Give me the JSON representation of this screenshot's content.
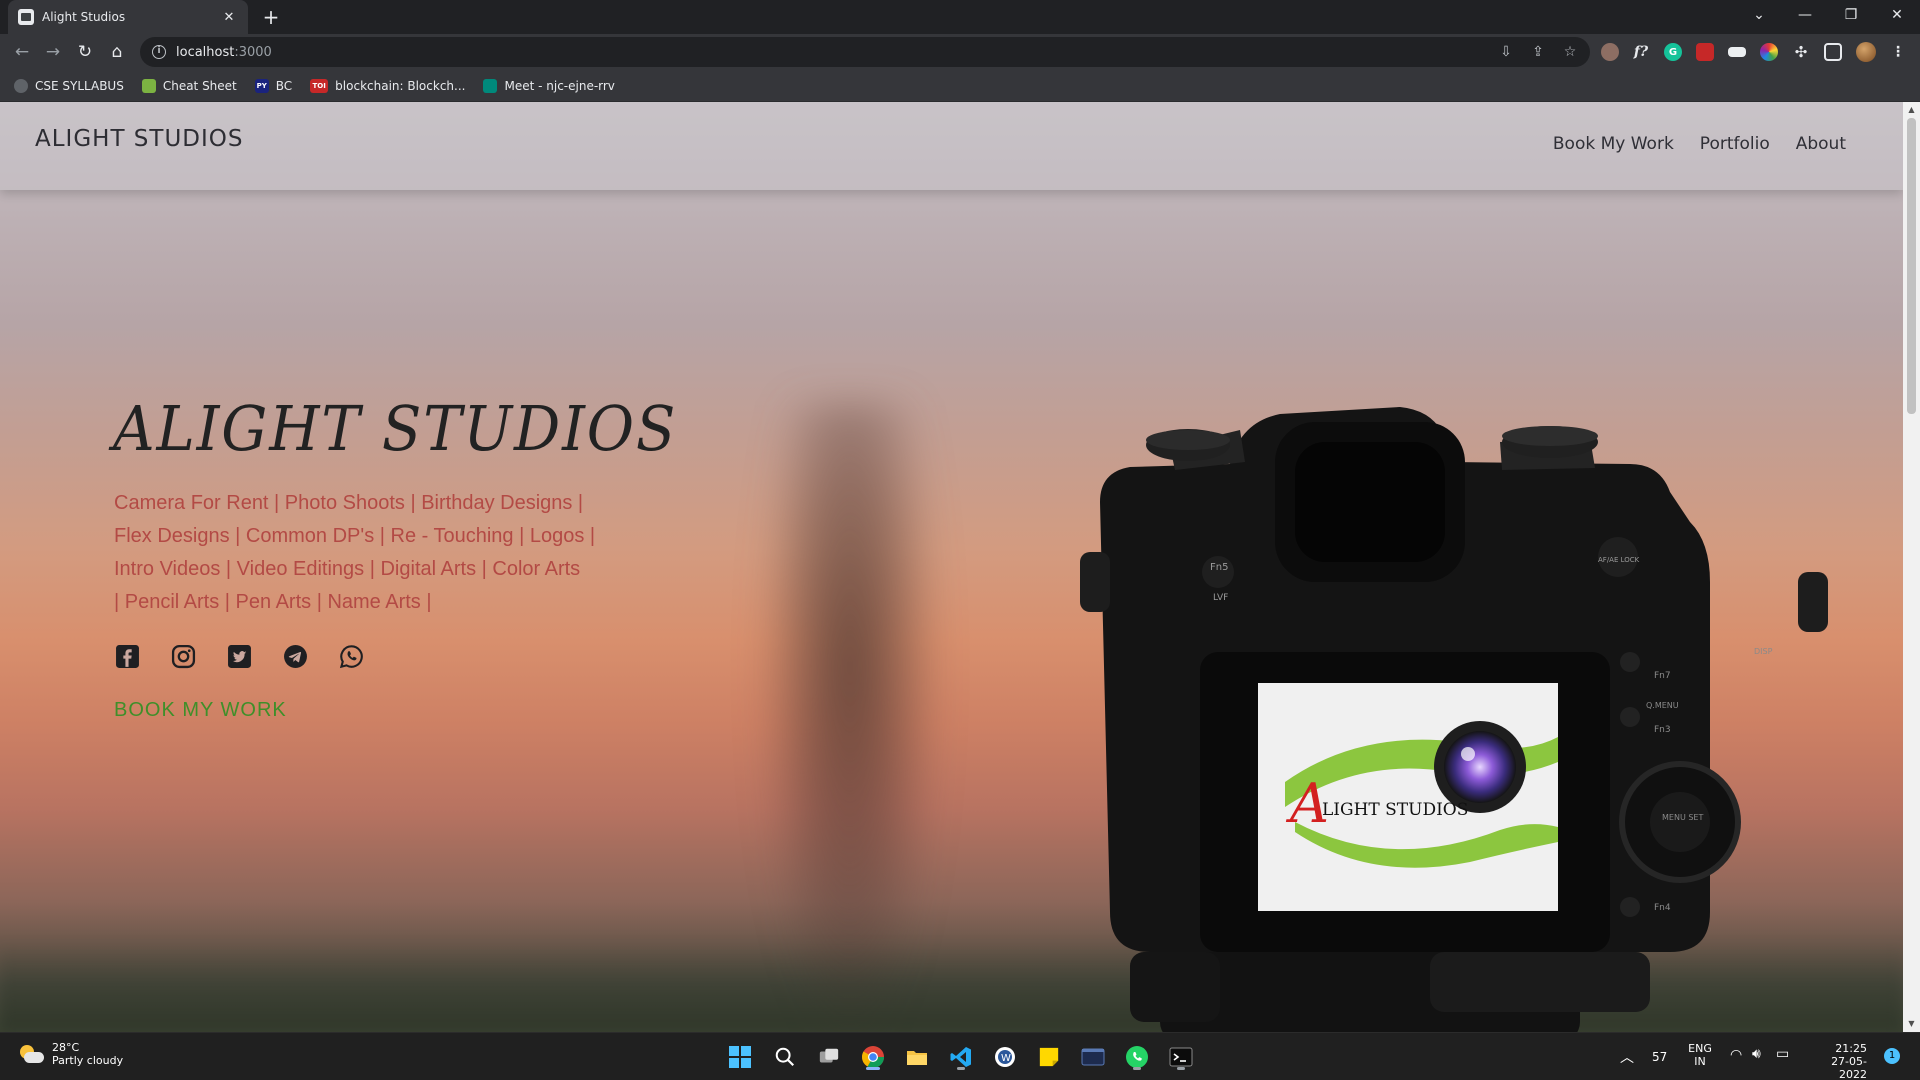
{
  "browser": {
    "tab_title": "Alight Studios",
    "tab_close": "✕",
    "new_tab": "+",
    "url_host": "localhost",
    "url_port": ":3000",
    "window_controls": [
      "⌄",
      "—",
      "❐",
      "✕"
    ]
  },
  "bookmarks": [
    {
      "label": "CSE SYLLABUS",
      "icon": "globe-icon",
      "color": "#5f6368",
      "glyph": ""
    },
    {
      "label": "Cheat Sheet",
      "icon": "cheat-sheet-icon",
      "color": "#7cb342",
      "glyph": ""
    },
    {
      "label": "BC",
      "icon": "py-icon",
      "color": "#1a237e",
      "glyph": "PY"
    },
    {
      "label": "blockchain: Blockch...",
      "icon": "toi-icon",
      "color": "#c62828",
      "glyph": "TOI"
    },
    {
      "label": "Meet - njc-ejne-rrv",
      "icon": "meet-icon",
      "color": "#00897b",
      "glyph": ""
    }
  ],
  "site": {
    "brand": "ALIGHT STUDIOS",
    "nav": [
      "Book My Work",
      "Portfolio",
      "About"
    ],
    "hero_title": "ALIGHT STUDIOS",
    "services_lines": [
      "Camera For Rent | Photo Shoots | Birthday Designs |",
      "Flex Designs | Common DP's | Re - Touching | Logos |",
      "Intro Videos | Video Editings | Digital Arts | Color Arts",
      "| Pencil Arts | Pen Arts | Name Arts |"
    ],
    "socials": [
      "facebook-icon",
      "instagram-icon",
      "twitter-icon",
      "telegram-icon",
      "whatsapp-icon"
    ],
    "cta": "BOOK MY WORK",
    "camera_screen_logo": "LIGHT STUDIOS",
    "camera_screen_logo_initial": "A",
    "camera_labels": [
      "Fn5",
      "LVF",
      "AF/AE LOCK",
      "DISP",
      "Fn7",
      "Q.MENU",
      "Fn3",
      "MENU SET",
      "Fn4"
    ]
  },
  "taskbar": {
    "temperature": "28°C",
    "weather": "Partly cloudy",
    "tray_count": "57",
    "lang_top": "ENG",
    "lang_bottom": "IN",
    "time": "21:25",
    "date": "27-05-2022",
    "notification_count": "1"
  },
  "colors": {
    "services_text": "#b34a45",
    "cta_text": "#3f8f2a",
    "chrome_bg": "#35363a"
  }
}
